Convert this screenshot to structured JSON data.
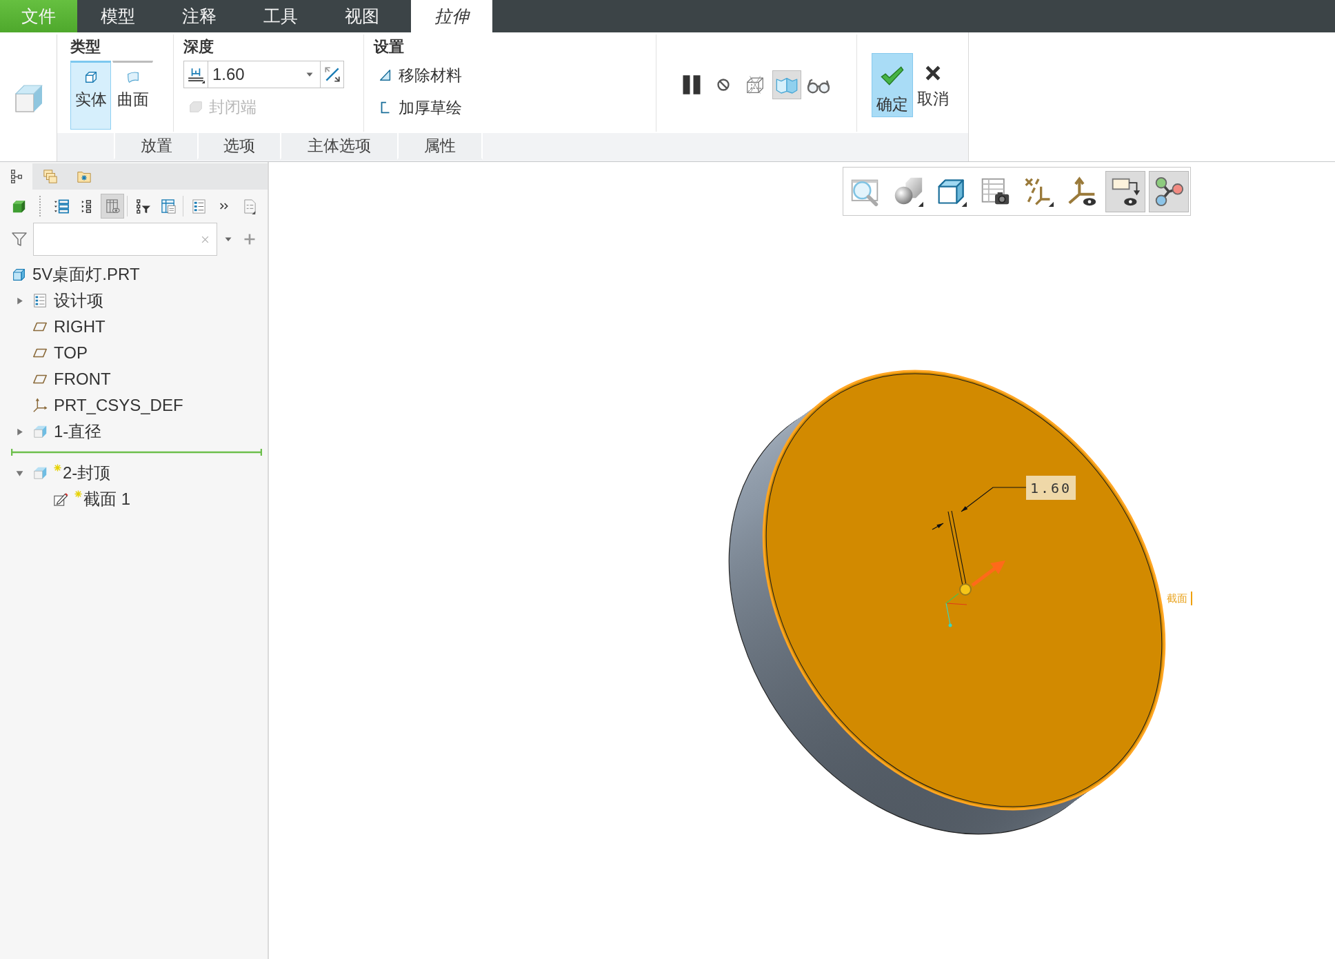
{
  "menu_tabs": [
    {
      "label": "文件",
      "kind": "file",
      "selected": false
    },
    {
      "label": "模型",
      "kind": "tab",
      "selected": false
    },
    {
      "label": "注释",
      "kind": "tab",
      "selected": false
    },
    {
      "label": "工具",
      "kind": "tab",
      "selected": false
    },
    {
      "label": "视图",
      "kind": "tab",
      "selected": false
    },
    {
      "label": "拉伸",
      "kind": "context",
      "selected": true
    }
  ],
  "ribbon": {
    "type": {
      "title": "类型",
      "options": [
        {
          "label": "实体",
          "kind": "solid",
          "selected": true
        },
        {
          "label": "曲面",
          "kind": "surface",
          "selected": false
        }
      ]
    },
    "depth": {
      "title": "深度",
      "value": "1.60",
      "cap_ends": {
        "label": "封闭端",
        "checked": false,
        "disabled": true
      }
    },
    "settings": {
      "title": "设置",
      "options": [
        {
          "label": "移除材料",
          "kind": "remove-material",
          "checked": false
        },
        {
          "label": "加厚草绘",
          "kind": "thicken",
          "checked": false
        }
      ]
    },
    "preview_tools": [
      {
        "kind": "pause",
        "selected": false
      },
      {
        "kind": "no-preview",
        "selected": false
      },
      {
        "kind": "wireframe",
        "selected": false
      },
      {
        "kind": "verify",
        "selected": true
      },
      {
        "kind": "glasses",
        "selected": false
      }
    ],
    "actions": [
      {
        "label": "确定",
        "kind": "ok",
        "highlighted": true
      },
      {
        "label": "取消",
        "kind": "cancel",
        "highlighted": false
      }
    ],
    "sub_tabs": [
      {
        "label": "放置",
        "selected": false
      },
      {
        "label": "选项",
        "selected": false
      },
      {
        "label": "主体选项",
        "selected": false
      },
      {
        "label": "属性",
        "selected": false
      }
    ]
  },
  "model_tree": {
    "panel_tabs": [
      {
        "kind": "tree",
        "selected": true
      },
      {
        "kind": "layers",
        "selected": false
      },
      {
        "kind": "favorites",
        "selected": false
      }
    ],
    "tool_groups": [
      [
        {
          "kind": "display",
          "selected": false
        }
      ],
      [
        {
          "kind": "tree-list",
          "selected": false
        },
        {
          "kind": "tree-expand",
          "selected": false
        },
        {
          "kind": "columns",
          "selected": true
        }
      ],
      [
        {
          "kind": "tree-filter",
          "selected": false
        },
        {
          "kind": "column-setup",
          "selected": false
        }
      ],
      [
        {
          "kind": "settings-list",
          "selected": false
        },
        {
          "kind": "more",
          "selected": false
        },
        {
          "kind": "document",
          "selected": false
        }
      ]
    ],
    "items": [
      {
        "label": "5V桌面灯.PRT",
        "kind": "part",
        "children": [
          {
            "label": "设计项",
            "kind": "design-items",
            "expanded": false
          },
          {
            "label": "RIGHT",
            "kind": "datum-plane"
          },
          {
            "label": "TOP",
            "kind": "datum-plane"
          },
          {
            "label": "FRONT",
            "kind": "datum-plane"
          },
          {
            "label": "PRT_CSYS_DEF",
            "kind": "csys"
          },
          {
            "label": "1-直径",
            "kind": "feature",
            "expanded": false
          },
          {
            "kind": "insert-marker"
          },
          {
            "label": "2-封顶",
            "kind": "feature",
            "expanded": true,
            "new": true,
            "children": [
              {
                "label": "截面 1",
                "kind": "sketch",
                "new": true
              }
            ]
          }
        ]
      }
    ]
  },
  "view_toolbar": [
    {
      "kind": "zoom",
      "selected": false
    },
    {
      "kind": "shading",
      "selected": false
    },
    {
      "kind": "view-cube",
      "selected": false
    },
    {
      "kind": "table-camera",
      "selected": false
    },
    {
      "kind": "datum-display",
      "selected": false
    },
    {
      "kind": "csys-display",
      "selected": false
    },
    {
      "kind": "annotation-display",
      "selected": true
    },
    {
      "kind": "graph",
      "selected": true
    }
  ],
  "viewport": {
    "dimension": "1.60",
    "section_label": "截面"
  }
}
